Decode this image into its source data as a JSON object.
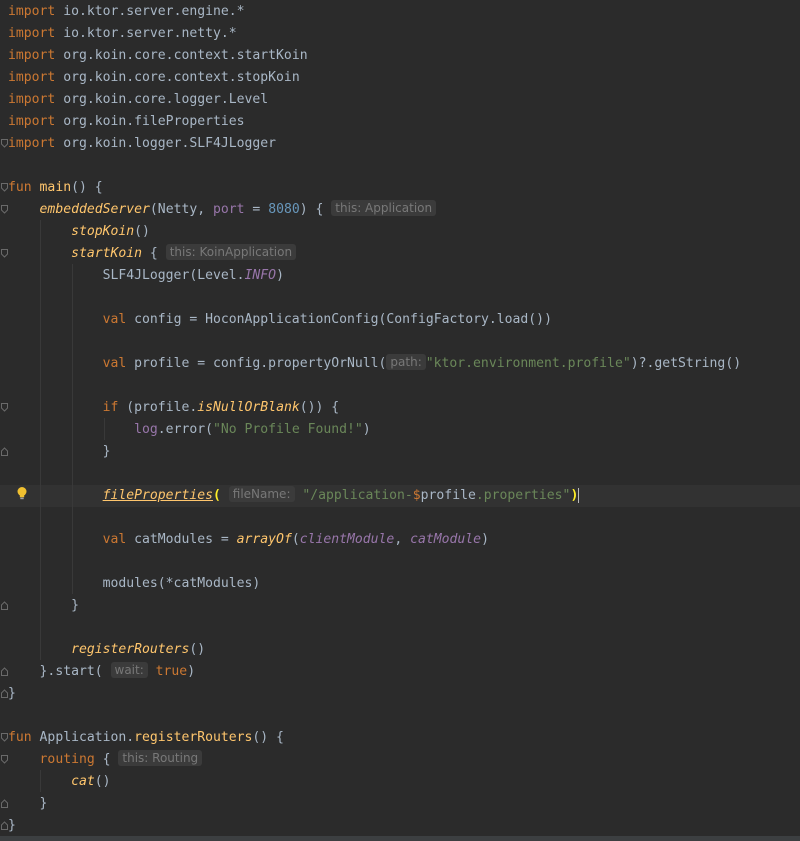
{
  "imports": [
    {
      "keyword": "import",
      "path": "io.ktor.server.engine.*"
    },
    {
      "keyword": "import",
      "path": "io.ktor.server.netty.*"
    },
    {
      "keyword": "import",
      "path": "org.koin.core.context.startKoin"
    },
    {
      "keyword": "import",
      "path": "org.koin.core.context.stopKoin"
    },
    {
      "keyword": "import",
      "path": "org.koin.core.logger.Level"
    },
    {
      "keyword": "import",
      "path": "org.koin.fileProperties"
    },
    {
      "keyword": "import",
      "path": "org.koin.logger.SLF4JLogger"
    }
  ],
  "code": {
    "kw_fun": "fun",
    "main_name": "main",
    "main_sig": "() {",
    "embedded": "embeddedServer",
    "embedded_args_a": "(Netty, ",
    "port_name": "port",
    "port_eq": " = ",
    "port_value": "8080",
    "embedded_args_b": ") {",
    "hint_application": "this: Application",
    "stop_koin": "stopKoin",
    "parens": "()",
    "start_koin": "startKoin",
    "brace_open": " {",
    "hint_koin": "this: KoinApplication",
    "slf_a": "SLF4JLogger(Level.",
    "slf_info": "INFO",
    "slf_b": ")",
    "kw_val": "val",
    "config_line": " config = HoconApplicationConfig(ConfigFactory.load())",
    "profile_a": " profile = config.propertyOrNull(",
    "hint_path": "path:",
    "profile_str": "\"ktor.environment.profile\"",
    "profile_b": ")?.getString()",
    "kw_if": "if",
    "if_a": " (profile.",
    "is_null": "isNullOrBlank",
    "if_b": "()) {",
    "log": "log",
    "log_a": ".error(",
    "log_str": "\"No Profile Found!\"",
    "log_b": ")",
    "close_brace": "}",
    "file_props": "fileProperties",
    "open_paren": "(",
    "hint_filename": "fileName:",
    "fp_str_a": "\"/application-",
    "fp_dollar": "$",
    "fp_profile": "profile",
    "fp_str_b": ".properties\"",
    "close_paren": ")",
    "cat_modules_a": " catModules = ",
    "array_of": "arrayOf",
    "cm_open": "(",
    "client_module": "clientModule",
    "comma": ", ",
    "cat_module": "catModule",
    "cm_close": ")",
    "modules_line": "modules(*catModules)",
    "register_routers": "registerRouters",
    "start_a": "}.start(",
    "hint_wait": "wait:",
    "kw_true": "true",
    "start_b": ")",
    "app_prefix": "Application.",
    "register_sig": "() {",
    "routing": "routing",
    "hint_routing": "this: Routing",
    "cat": "cat"
  },
  "colors": {
    "background": "#2b2b2b",
    "keyword": "#cc7832",
    "function": "#ffc66d",
    "string": "#6a8759",
    "number": "#6897bb",
    "property": "#9876aa",
    "text": "#a9b7c6"
  },
  "gutter": {
    "intention_icon": "lightbulb-icon"
  }
}
